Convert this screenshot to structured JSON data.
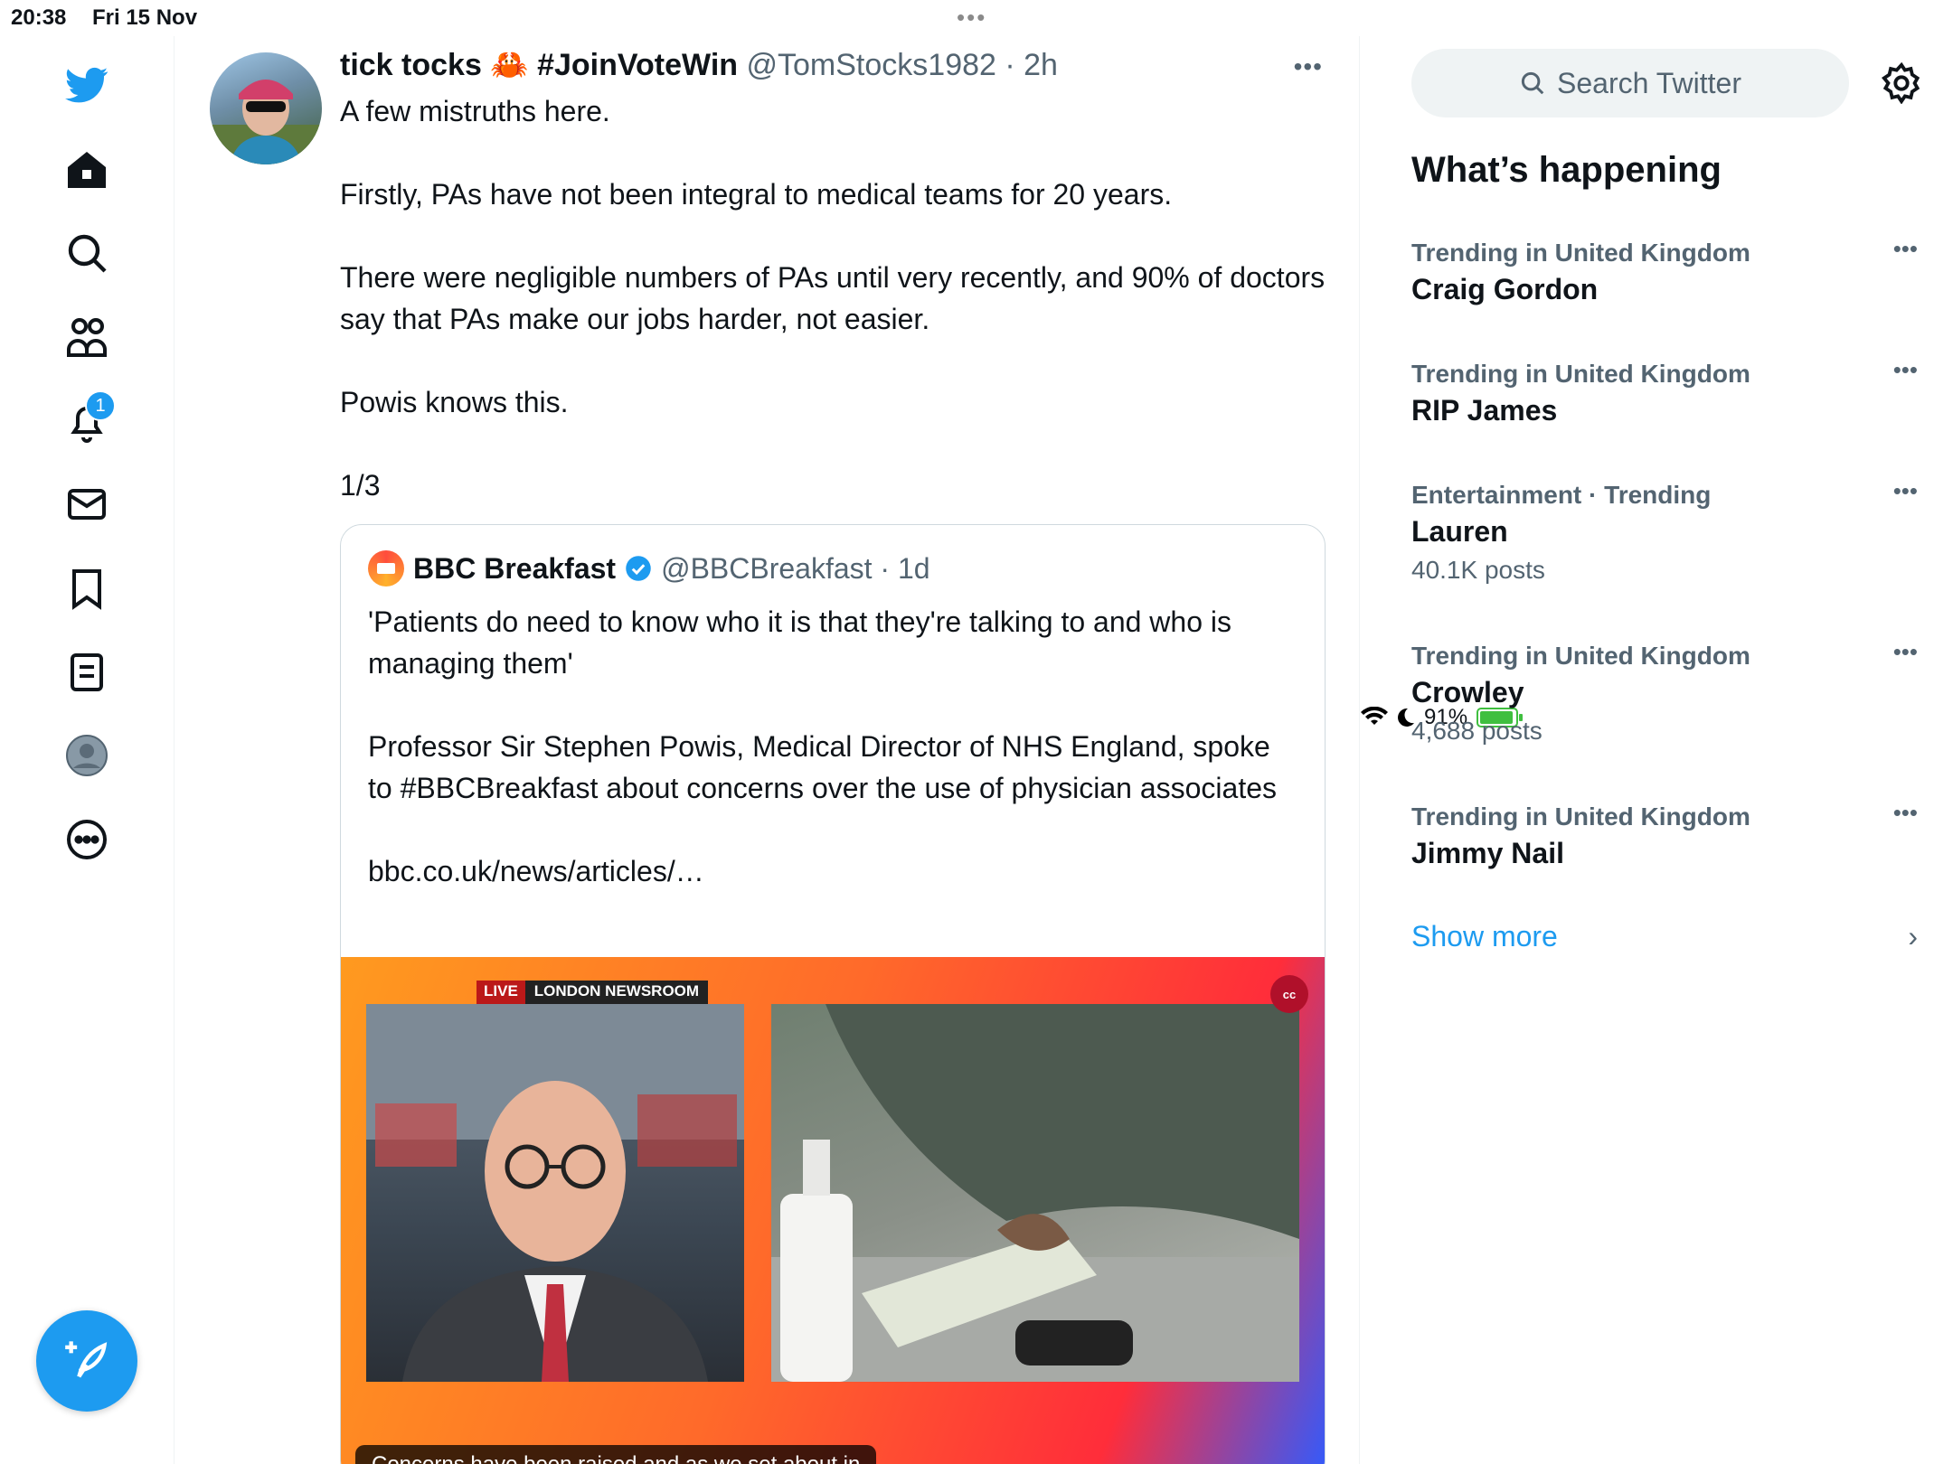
{
  "status_bar": {
    "time": "20:38",
    "date": "Fri 15 Nov",
    "battery": "91%"
  },
  "nav": {
    "notification_count": "1",
    "items": [
      "home",
      "explore",
      "communities",
      "notifications",
      "messages",
      "bookmarks",
      "lists",
      "profile",
      "more"
    ]
  },
  "tweet": {
    "name": "tick tocks 🦀 #JoinVoteWin",
    "handle": "@TomStocks1982 · 2h",
    "paragraphs": [
      "A few mistruths here.",
      "Firstly, PAs have not been integral to medical teams for 20 years.",
      "There were negligible numbers of PAs until very recently, and 90% of doctors say that PAs make our jobs harder, not easier.",
      "Powis knows this.",
      "1/3"
    ]
  },
  "quote": {
    "name": "BBC Breakfast",
    "handle": "@BBCBreakfast · 1d",
    "paragraphs": [
      "'Patients do need to know who it is that they're talking to and who is managing them'",
      "Professor Sir Stephen Powis, Medical Director of NHS England, spoke to #BBCBreakfast about concerns over the use of physician associates",
      "bbc.co.uk/news/articles/…"
    ],
    "media": {
      "live_label": "LIVE",
      "location_label": "LONDON NEWSROOM",
      "cc_label": "cc",
      "caption": "Concerns have been raised and as we set about in"
    }
  },
  "sidebar": {
    "search_placeholder": "Search Twitter",
    "heading": "What’s happening",
    "trends": [
      {
        "meta": "Trending in United Kingdom",
        "title": "Craig Gordon",
        "count": ""
      },
      {
        "meta": "Trending in United Kingdom",
        "title": "RIP James",
        "count": ""
      },
      {
        "meta": "Entertainment · Trending",
        "title": "Lauren",
        "count": "40.1K posts"
      },
      {
        "meta": "Trending in United Kingdom",
        "title": "Crowley",
        "count": "4,688 posts"
      },
      {
        "meta": "Trending in United Kingdom",
        "title": "Jimmy Nail",
        "count": ""
      }
    ],
    "show_more": "Show more"
  },
  "colors": {
    "accent": "#1d9bf0",
    "muted": "#536471",
    "text": "#0f1419"
  }
}
